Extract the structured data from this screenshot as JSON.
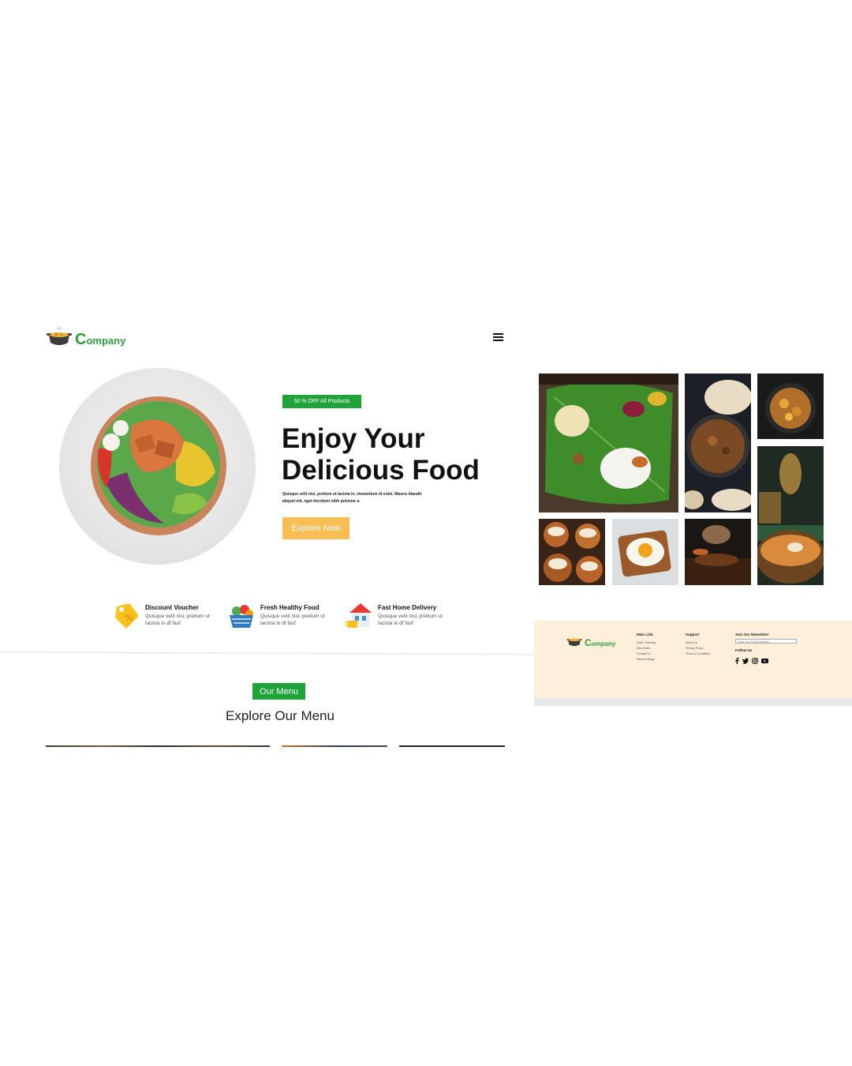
{
  "brand": {
    "logo_initial": "C",
    "logo_rest": "ompany"
  },
  "hero": {
    "badge": "50 % OFF  All Products",
    "title_line1": "Enjoy Your",
    "title_line2": "Delicious Food",
    "description": "Quisque velit nisi, pretium ut lacinia in, elementum id enim. Mauris blandit aliquet elit, eget tincidunt nibh pulvinar a.",
    "button": "Explore Now"
  },
  "features": [
    {
      "title": "Discount Voucher",
      "desc": "Quisque velit nisi, pretium ut lacinia in df fasf",
      "icon": "discount-tag-icon"
    },
    {
      "title": "Fresh Healthy Food",
      "desc": "Quisque velit nisi, pretium ut lacinia in df fasf",
      "icon": "vegetable-basket-icon"
    },
    {
      "title": "Fast Home Delivery",
      "desc": "Quisque velit nisi, pretium ut lacinia in df fasf",
      "icon": "delivery-house-icon"
    }
  ],
  "menu_section": {
    "badge": "Our Menu",
    "title": "Explore Our Menu"
  },
  "footer": {
    "main_link": {
      "title": "Main Link",
      "items": [
        "Order Tracking",
        "New Order",
        "Contact Us",
        "News & Blogs"
      ]
    },
    "support": {
      "title": "Support",
      "items": [
        "About Us",
        "Privacy Policy",
        "Terms & Conditions"
      ]
    },
    "newsletter": {
      "title": "Join Our Newsletter",
      "placeholder": "Enter Your Email Address"
    },
    "follow": "Follow Us",
    "social": [
      "f",
      "t",
      "ig",
      "yt"
    ]
  },
  "colors": {
    "green": "#20a43a",
    "orange": "#f9bd55",
    "footer_bg": "#fdefd9"
  }
}
